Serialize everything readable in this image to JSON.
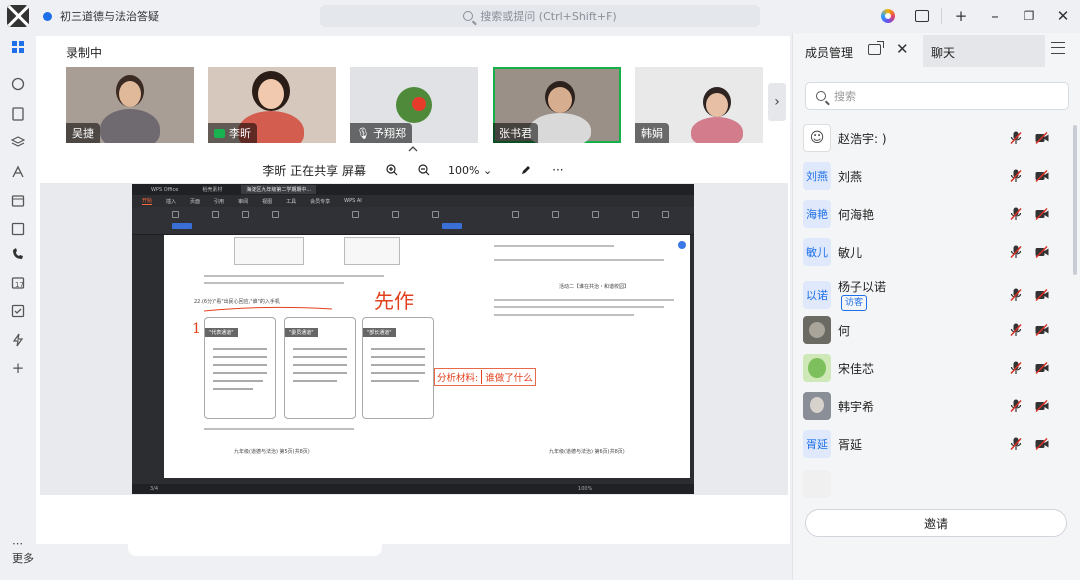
{
  "window": {
    "tab_title": "初三道德与法治答疑",
    "search_placeholder": "搜索或提问 (Ctrl+Shift+F)"
  },
  "left_nav": {
    "more_label": "更多",
    "icons": [
      "home-icon",
      "chat-icon",
      "docs-icon",
      "apps-icon",
      "ai-icon",
      "calendar-icon",
      "contacts-icon",
      "meeting-icon",
      "schedule-icon",
      "tasks-icon",
      "bolt-icon",
      "add-icon"
    ]
  },
  "meeting": {
    "recording_label": "录制中",
    "participants": [
      {
        "name": "吴捷",
        "sharing": false,
        "active": false
      },
      {
        "name": "李昕",
        "sharing": true,
        "active": false
      },
      {
        "name": "予翔郑",
        "sharing": false,
        "active": false,
        "mic_off": true
      },
      {
        "name": "张书君",
        "sharing": false,
        "active": true
      },
      {
        "name": "韩娟",
        "sharing": false,
        "active": false
      }
    ],
    "share_status": "李昕 正在共享 屏幕",
    "zoom_level": "100%"
  },
  "shared_screen": {
    "app_name": "WPS Office",
    "tabs": [
      "WPS Office",
      "稻壳素材",
      "海淀区九年级第二学期期中..."
    ],
    "menus": [
      "开始",
      "插入",
      "页面",
      "引用",
      "审阅",
      "视图",
      "工具",
      "会员专享",
      "WPS AI"
    ],
    "annotation_label": "分析材料:",
    "annotation_input": "谁做了什么",
    "handwritten_title": "先作",
    "question_text": "22.(6分)\"看\"出民心回应,\"谁\"的入手机",
    "cards": [
      "\"代表通道\"",
      "\"委员通道\"",
      "\"部长通道\""
    ],
    "footer_left": "九年级(道德与法治) 第5页(共8页)",
    "footer_right": "九年级(道德与法治) 第6页(共8页)",
    "right_section_title": "活动二【谁在共治・和谐校园】",
    "status_page": "3/4",
    "status_zoom": "100%"
  },
  "right_panel": {
    "members_tab": "成员管理",
    "chat_tab": "聊天",
    "search_placeholder": "搜索",
    "members": [
      {
        "name": "赵浩宇: )",
        "avatar_text": "",
        "avatar_style": "photo"
      },
      {
        "name": "刘燕",
        "avatar_text": "刘燕",
        "avatar_style": "text"
      },
      {
        "name": "何海艳",
        "avatar_text": "海艳",
        "avatar_style": "text"
      },
      {
        "name": "敏儿",
        "avatar_text": "敏儿",
        "avatar_style": "text"
      },
      {
        "name": "杨子以诺",
        "avatar_text": "以诺",
        "avatar_style": "text",
        "guest_label": "访客"
      },
      {
        "name": "何",
        "avatar_text": "",
        "avatar_style": "photo"
      },
      {
        "name": "宋佳芯",
        "avatar_text": "",
        "avatar_style": "photo"
      },
      {
        "name": "韩宇希",
        "avatar_text": "",
        "avatar_style": "photo"
      },
      {
        "name": "胥延",
        "avatar_text": "胥延",
        "avatar_style": "text"
      }
    ],
    "invite_label": "邀请"
  },
  "colors": {
    "accent": "#1e6fe8",
    "active_tile": "#15b04a",
    "annotation": "#e2401c",
    "muted_red": "#d93026"
  }
}
